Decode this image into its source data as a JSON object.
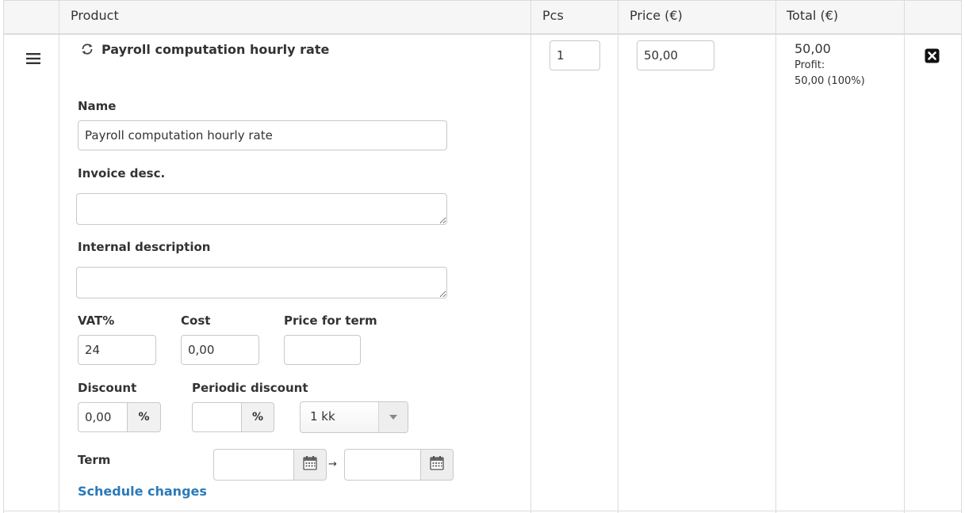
{
  "table": {
    "headers": {
      "product": "Product",
      "pcs": "Pcs",
      "price": "Price (€)",
      "total": "Total (€)"
    }
  },
  "row": {
    "product_name": "Payroll computation hourly rate",
    "pcs": "1",
    "price": "50,00",
    "total": "50,00",
    "profit_label": "Profit:",
    "profit_value": "50,00 (100%)"
  },
  "form": {
    "name_label": "Name",
    "name_value": "Payroll computation hourly rate",
    "invoice_desc_label": "Invoice desc.",
    "invoice_desc_value": "",
    "internal_desc_label": "Internal description",
    "internal_desc_value": "",
    "vat_label": "VAT%",
    "vat_value": "24",
    "cost_label": "Cost",
    "cost_value": "0,00",
    "price_term_label": "Price for term",
    "price_term_value": "",
    "discount_label": "Discount",
    "discount_value": "0,00",
    "discount_unit": "%",
    "periodic_discount_label": "Periodic discount",
    "periodic_discount_value": "",
    "periodic_discount_unit": "%",
    "period_select_value": "1 kk",
    "term_label": "Term",
    "term_start": "",
    "term_arrow": "→",
    "term_end": "",
    "schedule_link": "Schedule changes"
  },
  "icons": {
    "drag": "hamburger-icon",
    "recurring": "recurring-icon",
    "remove": "close-square-icon",
    "calendar": "calendar-icon"
  }
}
